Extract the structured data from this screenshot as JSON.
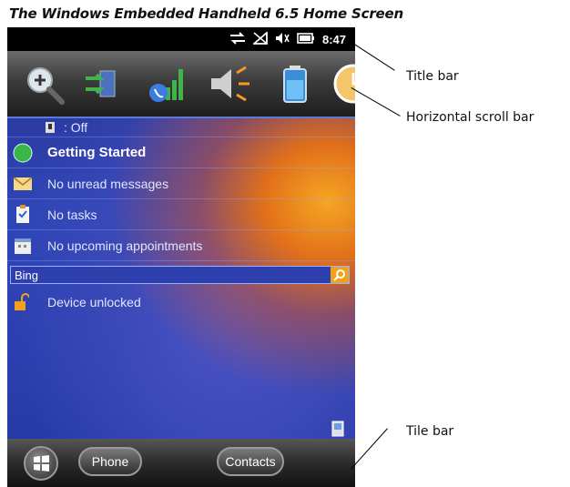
{
  "caption": "The Windows Embedded Handheld 6.5 Home Screen",
  "status_bar": {
    "icons": [
      "connectivity-icon",
      "signal-icon",
      "volume-icon",
      "battery-icon"
    ],
    "time": "8:47"
  },
  "scroll_bar": {
    "items": [
      "zoom-icon",
      "sync-icon",
      "phone-signal-icon",
      "speaker-icon",
      "battery-icon",
      "clock-icon"
    ]
  },
  "home": {
    "first_row": ": Off",
    "items": [
      {
        "icon": "green-dot-icon",
        "label": "Getting Started"
      },
      {
        "icon": "envelope-icon",
        "label": "No unread messages"
      },
      {
        "icon": "tasks-icon",
        "label": "No tasks"
      },
      {
        "icon": "calendar-icon",
        "label": "No upcoming appointments"
      }
    ],
    "search": {
      "value": "Bing"
    },
    "lock_status": "Device unlocked"
  },
  "tile_bar": {
    "phone": "Phone",
    "contacts": "Contacts"
  },
  "callouts": {
    "title_bar": "Title bar",
    "scroll_bar": "Horizontal scroll bar",
    "tile_bar": "Tile bar"
  },
  "colors": {
    "accent_orange": "#f2a21a",
    "title_bar": "#000000",
    "home_blue": "#2f46b7"
  }
}
